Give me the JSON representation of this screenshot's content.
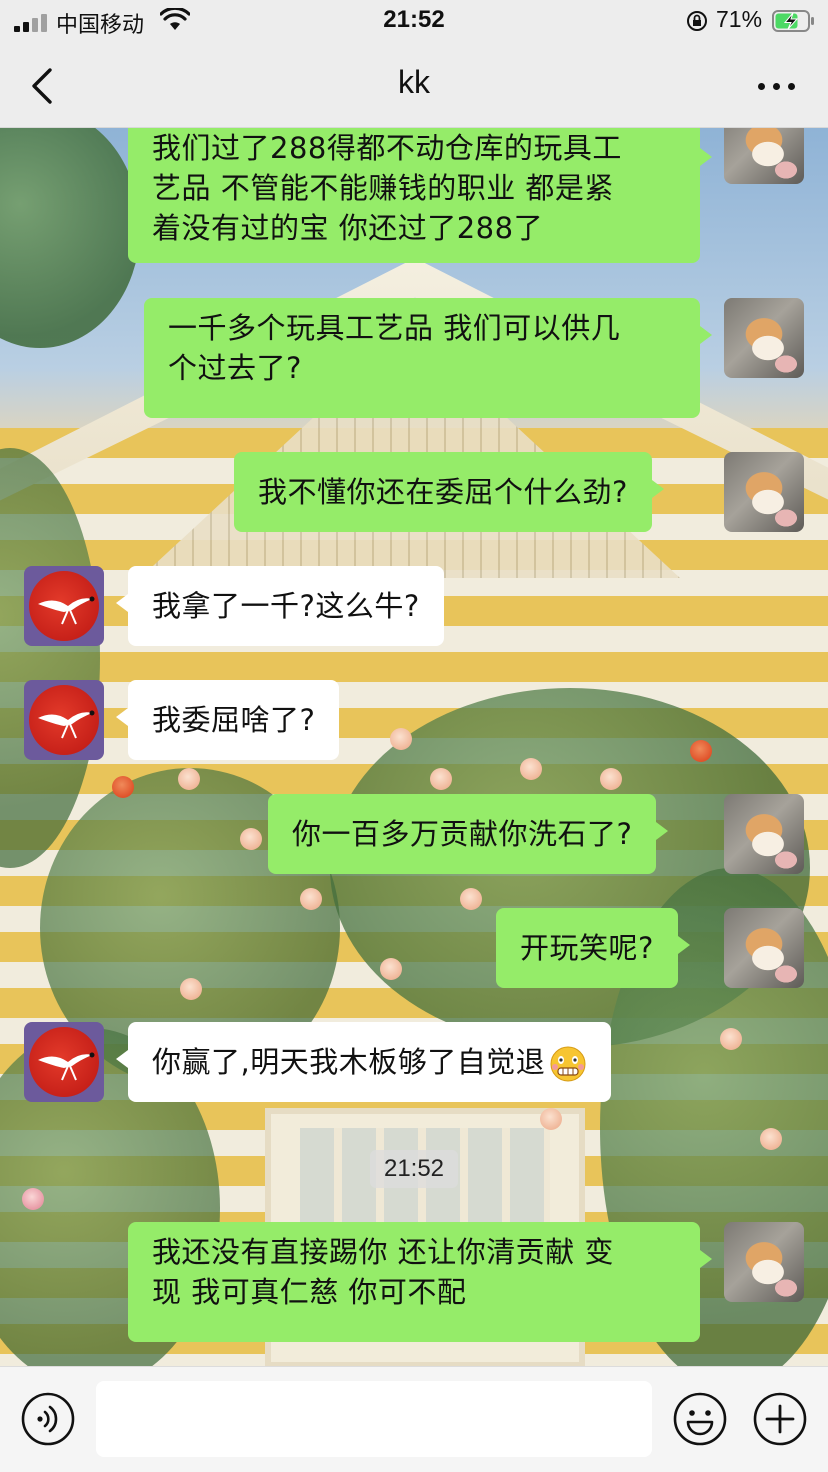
{
  "status_bar": {
    "carrier": "中国移动",
    "time": "21:52",
    "battery_percent": "71%",
    "battery_level": 0.71,
    "icons": [
      "signal-icon",
      "wifi-icon",
      "orientation-lock-icon",
      "battery-charging-icon"
    ]
  },
  "nav": {
    "title": "kk",
    "back_icon": "chevron-left-icon",
    "more_icon": "more-dots-icon"
  },
  "messages": [
    {
      "sender": "me",
      "text_lines": [
        "我们过了288得都不动仓库的玩具工",
        "艺品  不管能不能赚钱的职业  都是紧",
        "着没有过的宝  你还过了288了"
      ]
    },
    {
      "sender": "me",
      "text_lines": [
        "一千多个玩具工艺品  我们可以供几",
        "个过去了?"
      ]
    },
    {
      "sender": "me",
      "text_lines": [
        "我不懂你还在委屈个什么劲?"
      ]
    },
    {
      "sender": "other",
      "text_lines": [
        "我拿了一千?这么牛?"
      ]
    },
    {
      "sender": "other",
      "text_lines": [
        "我委屈啥了?"
      ]
    },
    {
      "sender": "me",
      "text_lines": [
        "你一百多万贡献你洗石了?"
      ]
    },
    {
      "sender": "me",
      "text_lines": [
        "开玩笑呢?"
      ]
    },
    {
      "sender": "other",
      "text_lines": [
        "你赢了,明天我木板够了自觉退"
      ],
      "trailing_emoji": "grimacing-sweat-emoji"
    },
    {
      "sender": "me",
      "text_lines": [
        "我还没有直接踢你  还让你清贡献  变",
        "现  我可真仁慈  你可不配"
      ]
    }
  ],
  "timestamp": "21:52",
  "input_bar": {
    "value": "",
    "placeholder": "",
    "icons": [
      "voice-icon",
      "emoji-icon",
      "plus-icon"
    ]
  },
  "colors": {
    "bubble_me": "#95ec69",
    "bubble_other": "#ffffff",
    "bar_bg": "#ededed"
  }
}
